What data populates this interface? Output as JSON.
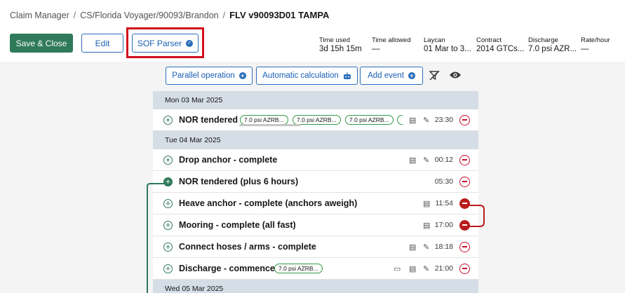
{
  "breadcrumb": {
    "items": [
      "Claim Manager",
      "CS/Florida Voyager/90093/Brandon"
    ],
    "current": "FLV v90093D01 TAMPA"
  },
  "header_buttons": {
    "save_close": "Save & Close",
    "edit": "Edit",
    "sof_parser": "SOF Parser"
  },
  "stats": [
    {
      "label": "Time used",
      "value": "3d 15h 15m"
    },
    {
      "label": "Time allowed",
      "value": "—"
    },
    {
      "label": "Laycan",
      "value": "01 Mar to 3..."
    },
    {
      "label": "Contract",
      "value": "2014 GTCs..."
    },
    {
      "label": "Discharge",
      "value": "7.0 psi AZR..."
    },
    {
      "label": "Rate/hour",
      "value": "—"
    }
  ],
  "toolbar": {
    "parallel": "Parallel operation",
    "automatic": "Automatic calculation",
    "add_event": "Add event"
  },
  "days": [
    "Mon 03 Mar 2025",
    "Tue 04 Mar 2025",
    "Wed 05 Mar 2025"
  ],
  "events": [
    {
      "title": "NOR tendered",
      "time": "23:30",
      "tags": [
        "7.0 psi AZRB...",
        "7.0 psi AZRB...",
        "7.0 psi AZRB..."
      ]
    },
    {
      "title": "Drop anchor - complete",
      "time": "00:12"
    },
    {
      "title": "NOR tendered (plus 6 hours)",
      "time": "05:30"
    },
    {
      "title": "Heave anchor - complete (anchors aweigh)",
      "time": "11:54"
    },
    {
      "title": "Mooring - complete (all fast)",
      "time": "17:00"
    },
    {
      "title": "Connect hoses / arms - complete",
      "time": "18:18"
    },
    {
      "title": "Discharge - commence",
      "time": "21:00",
      "tags": [
        "7.0 psi AZRB..."
      ]
    }
  ],
  "colors": {
    "primary_green": "#2f7a5a",
    "accent_blue": "#2a6ebb",
    "danger_red": "#c8102e",
    "highlight_red": "#d0101b",
    "day_header": "#d5dde6"
  }
}
